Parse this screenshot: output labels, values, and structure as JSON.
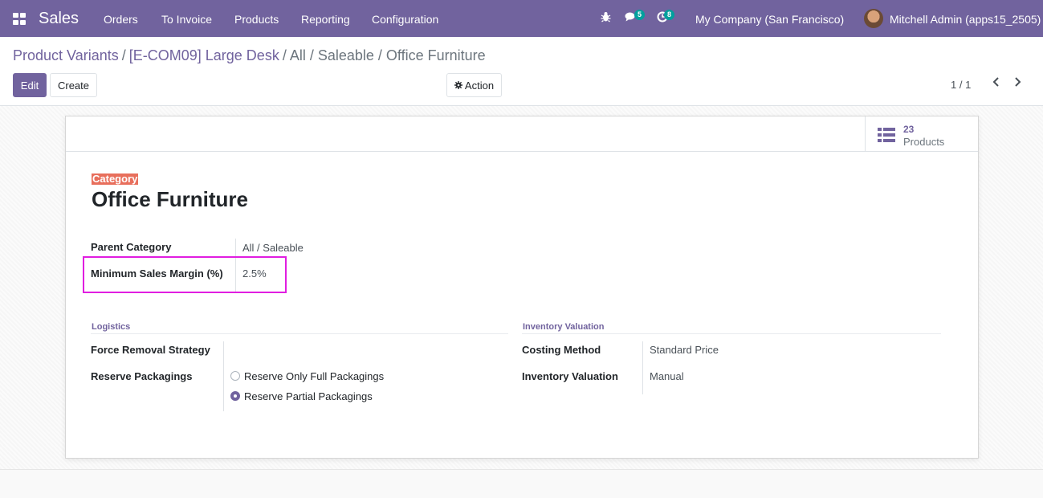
{
  "navbar": {
    "app_name": "Sales",
    "menu": [
      "Orders",
      "To Invoice",
      "Products",
      "Reporting",
      "Configuration"
    ],
    "messages_count": "5",
    "activities_count": "8",
    "company": "My Company (San Francisco)",
    "user": "Mitchell Admin (apps15_2505)"
  },
  "breadcrumb": {
    "item1": "Product Variants",
    "item2": "[E-COM09] Large Desk",
    "current": "All / Saleable / Office Furniture",
    "separator": "/"
  },
  "buttons": {
    "edit": "Edit",
    "create": "Create",
    "action": "Action"
  },
  "pager": {
    "value": "1 / 1"
  },
  "stat_button": {
    "value": "23",
    "label": "Products"
  },
  "form": {
    "category_label": "Category",
    "name": "Office Furniture",
    "parent_category_label": "Parent Category",
    "parent_category_value": "All / Saleable",
    "min_margin_label": "Minimum Sales Margin (%)",
    "min_margin_value": "2.5%",
    "logistics_title": "Logistics",
    "removal_strategy_label": "Force Removal Strategy",
    "removal_strategy_value": "",
    "reserve_packagings_label": "Reserve Packagings",
    "reserve_options": [
      "Reserve Only Full Packagings",
      "Reserve Partial Packagings"
    ],
    "reserve_selected_index": 1,
    "inventory_valuation_title": "Inventory Valuation",
    "costing_method_label": "Costing Method",
    "costing_method_value": "Standard Price",
    "inventory_valuation_label": "Inventory Valuation",
    "inventory_valuation_value": "Manual"
  },
  "colors": {
    "brand": "#71639e",
    "badge": "#00a09d",
    "category_tag": "#e86f5c",
    "highlight": "#e01ee0"
  },
  "icons": {
    "apps": "apps-grid-icon",
    "bug": "bug-icon",
    "chat": "chat-icon",
    "activity": "clock-icon",
    "action": "gear-icon",
    "prev": "chevron-left-icon",
    "next": "chevron-right-icon",
    "stat": "list-icon"
  }
}
